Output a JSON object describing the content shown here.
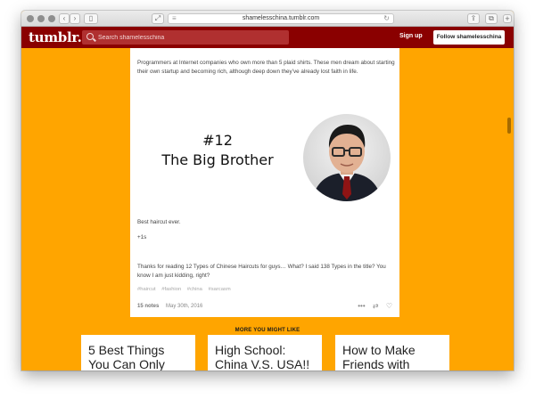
{
  "browser": {
    "url": "shamelesschina.tumblr.com",
    "icons": {
      "back": "chevron-left-icon",
      "forward": "chevron-right-icon",
      "sidebar": "sidebar-icon",
      "reader": "reader-icon",
      "reload": "reload-icon",
      "share": "share-icon",
      "tabs": "tabs-icon"
    }
  },
  "header": {
    "logo": "tumblr.",
    "search_placeholder": "Search shamelesschina",
    "signup_label": "Sign up",
    "follow_label": "Follow shamelesschina",
    "background_color": "#8a0000"
  },
  "page": {
    "background_color": "#FFA500"
  },
  "post": {
    "intro": "Programmers at Internet companies who own more than 5 plaid shirts. These men dream about starting their own startup and becoming rich, although deep down they’ve already lost faith in life.",
    "heading_number": "#12",
    "heading_title": "The Big Brother",
    "caption": "Best haircut ever.",
    "plus_one": "+1s",
    "outro": "Thanks for reading 12 Types of Chinese Haircuts for guys… What? I said 138 Types in the title? You know I am just kidding, right?",
    "tags": [
      "#haircut",
      "#fashion",
      "#china",
      "#sarcasm"
    ],
    "notes": "15 notes",
    "date": "May 30th, 2016"
  },
  "more": {
    "label": "MORE YOU MIGHT LIKE",
    "cards": [
      {
        "title": "5 Best Things You Can Only"
      },
      {
        "title": "High School: China V.S. USA!!"
      },
      {
        "title": "How to Make Friends with"
      }
    ]
  }
}
